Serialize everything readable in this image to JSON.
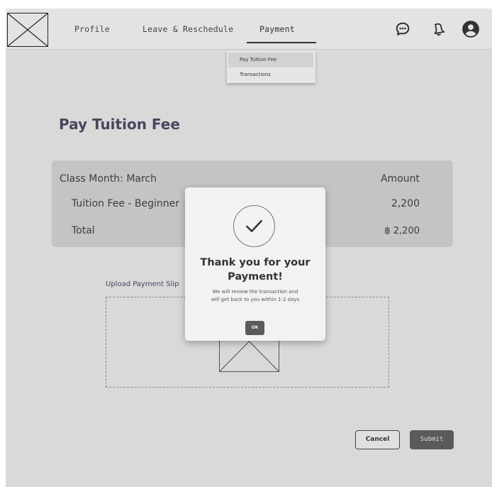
{
  "header": {
    "logo": "image-placeholder-icon",
    "nav": {
      "profile": "Profile",
      "leave_reschedule": "Leave & Reschedule",
      "payment": "Payment"
    },
    "icons": [
      "chat-icon",
      "bell-icon",
      "user-icon"
    ]
  },
  "dropdown": {
    "items": [
      "Pay Tuition Fee",
      "Transactions"
    ],
    "selected": "Pay Tuition Fee"
  },
  "main": {
    "title": "Pay Tuition Fee",
    "fee_table": {
      "class_month": "Class Month: March",
      "amount_header": "Amount",
      "rows": [
        {
          "label": "Tuition Fee - Beginner",
          "amount": "2,200"
        }
      ],
      "total_label": "Total",
      "total_amount": "฿ 2,200"
    },
    "upload": {
      "label": "Upload Payment Slip"
    },
    "buttons": {
      "cancel": "Cancel",
      "submit": "Submit"
    }
  },
  "modal": {
    "icon": "check-icon",
    "title_line1": "Thank you for your",
    "title_line2": "Payment!",
    "message_line1": "We will review the transaction and",
    "message_line2": "will get back to you within 1-2 days",
    "ok_label": "OK"
  },
  "colors": {
    "background": "#d9d9d9",
    "header": "#e3e3e3",
    "title": "#4a4560",
    "button_dark": "#5a5a5a"
  }
}
